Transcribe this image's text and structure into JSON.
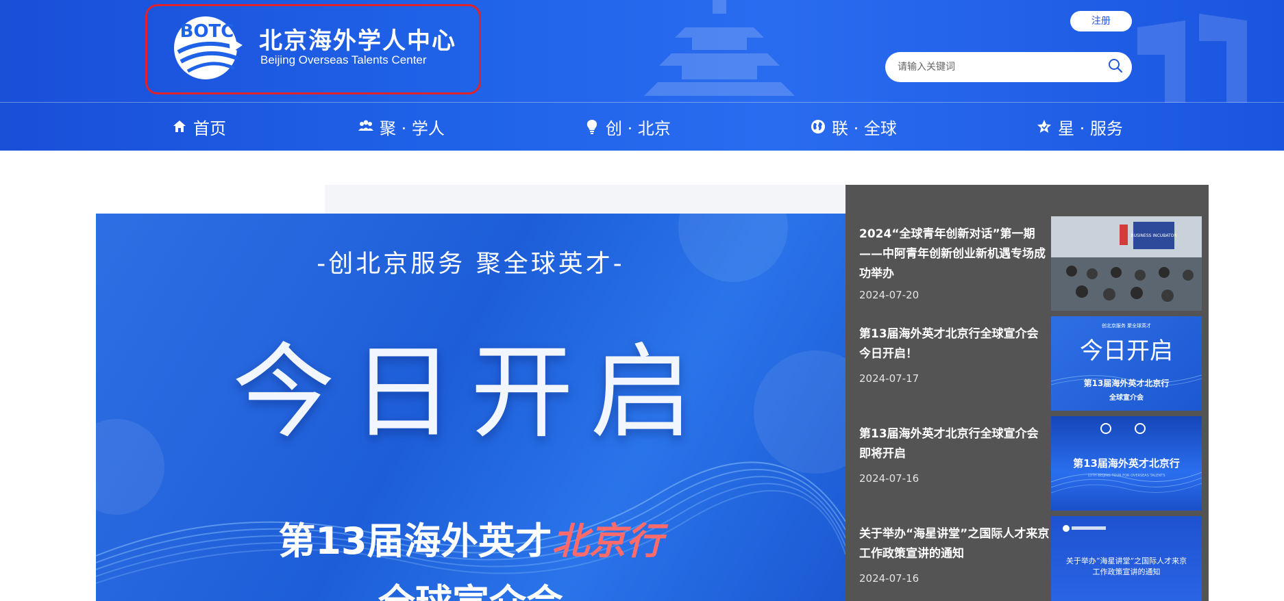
{
  "header": {
    "logo": {
      "abbr": "BOTC",
      "name_cn": "北京海外学人中心",
      "name_en": "Beijing Overseas Talents Center"
    },
    "register_label": "注册",
    "search": {
      "placeholder": "请输入关键词",
      "value": ""
    }
  },
  "nav": {
    "items": [
      {
        "label": "首页",
        "icon": "home-icon"
      },
      {
        "label": "聚 · 学人",
        "icon": "users-icon"
      },
      {
        "label": "创 · 北京",
        "icon": "bulb-icon"
      },
      {
        "label": "联 · 全球",
        "icon": "globe-icon"
      },
      {
        "label": "星 · 服务",
        "icon": "star-icon"
      }
    ]
  },
  "banner": {
    "slogan": "-创北京服务 聚全球英才-",
    "headline": "今日开启",
    "event_prefix": "第13届海外英才",
    "event_accent": "北京行",
    "event_sub": "全球宣介会"
  },
  "news": [
    {
      "title": "2024“全球青年创新对话”第一期——中阿青年创新创业新机遇专场成功举办",
      "date": "2024-07-20",
      "thumb_badge": "BUSINESS INCUBATOR"
    },
    {
      "title": "第13届海外英才北京行全球宣介会今日开启！",
      "date": "2024-07-17",
      "thumb_slogan": "创北京服务 聚全球英才",
      "thumb_headline": "今日开启",
      "thumb_event": "第13届海外英才北京行",
      "thumb_sub": "全球宣介会"
    },
    {
      "title": "第13届海外英才北京行全球宣介会即将开启",
      "date": "2024-07-16",
      "thumb_headline": "第13届海外英才北京行",
      "thumb_en": "13TH BEIJING TOUR FOR OVERSEAS TALENTS"
    },
    {
      "title": "关于举办“海星讲堂”之国际人才来京工作政策宣讲的通知",
      "date": "2024-07-16",
      "thumb_text": "关于举办“海星讲堂”之国际人才来京工作政策宣讲的通知"
    }
  ],
  "colors": {
    "header_blue": "#1f62e8",
    "highlight_red": "#e0222b",
    "news_panel": "#545454",
    "accent_red": "#ff6b6b"
  }
}
